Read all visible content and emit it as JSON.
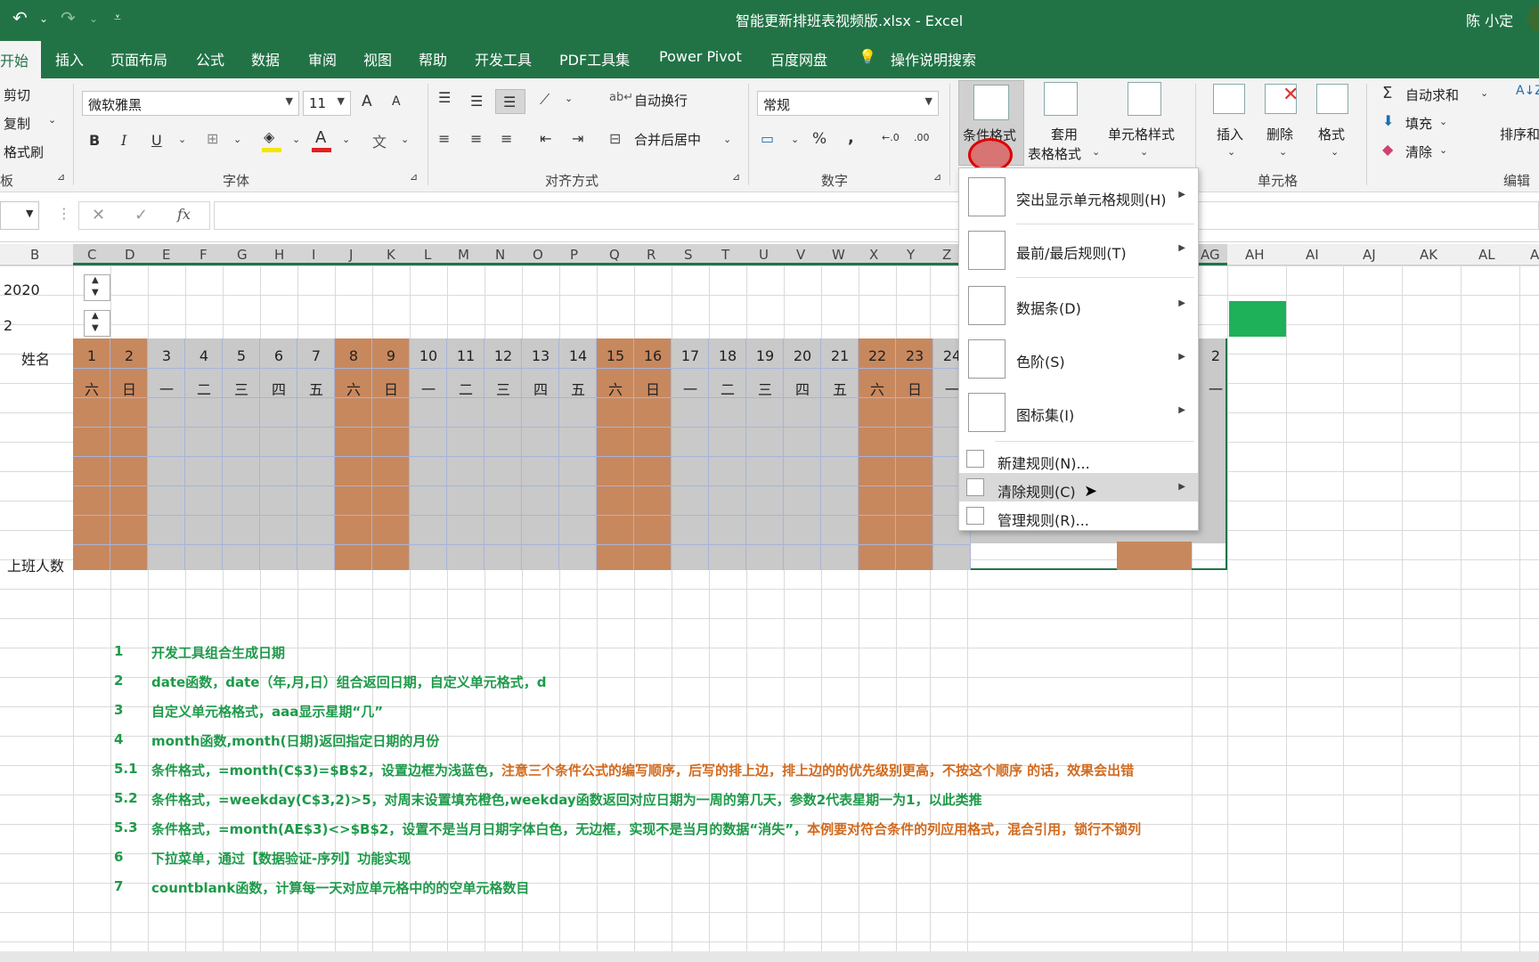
{
  "title": {
    "file": "智能更新排班表视频版.xlsx - Excel",
    "user": "陈 小定"
  },
  "tabs": [
    "开始",
    "插入",
    "页面布局",
    "公式",
    "数据",
    "审阅",
    "视图",
    "帮助",
    "开发工具",
    "PDF工具集",
    "Power Pivot",
    "百度网盘",
    "操作说明搜索"
  ],
  "ribbon": {
    "clipboard": {
      "cut": "剪切",
      "copy": "复制",
      "painter": "格式刷",
      "label": "板"
    },
    "font": {
      "name": "微软雅黑",
      "size": "11",
      "label": "字体",
      "bold": "B",
      "italic": "I",
      "underline": "U",
      "wen": "文",
      "grow": "A",
      "shrink": "A",
      "color_a": "A"
    },
    "align": {
      "wrap": "自动换行",
      "merge": "合并后居中",
      "label": "对齐方式"
    },
    "number": {
      "format": "常规",
      "label": "数字",
      "pct": "%",
      "comma": ",",
      "inc": "←.0",
      "dec": ".00"
    },
    "styles": {
      "cf": "条件格式",
      "table": "套用",
      "table2": "表格格式",
      "cell": "单元格样式"
    },
    "cells": {
      "insert": "插入",
      "delete": "删除",
      "format": "格式",
      "label": "单元格"
    },
    "edit": {
      "autosum": "自动求和",
      "fill": "填充",
      "clear": "清除",
      "sort": "排序和",
      "label": "编辑",
      "sigma": "Σ"
    }
  },
  "formula": {
    "cancel": "✕",
    "enter": "✓",
    "fx": "fx"
  },
  "columns": [
    "B",
    "C",
    "D",
    "E",
    "F",
    "G",
    "H",
    "I",
    "J",
    "K",
    "L",
    "M",
    "N",
    "O",
    "P",
    "Q",
    "R",
    "S",
    "T",
    "U",
    "V",
    "W",
    "X",
    "Y",
    "Z",
    "AG",
    "AH",
    "AI",
    "AJ",
    "AK",
    "AL",
    "A"
  ],
  "sheet": {
    "year": "2020",
    "month": "2",
    "name_label": "姓名",
    "count_label": "上班人数",
    "days": [
      "1",
      "2",
      "3",
      "4",
      "5",
      "6",
      "7",
      "8",
      "9",
      "10",
      "11",
      "12",
      "13",
      "14",
      "15",
      "16",
      "17",
      "18",
      "19",
      "20",
      "21",
      "22",
      "23",
      "24"
    ],
    "weekdays": [
      "六",
      "日",
      "一",
      "二",
      "三",
      "四",
      "五",
      "六",
      "日",
      "一",
      "二",
      "三",
      "四",
      "五",
      "六",
      "日",
      "一",
      "二",
      "三",
      "四",
      "五",
      "六",
      "日",
      "一"
    ],
    "last_day": "2",
    "last_wd": "一"
  },
  "notes": [
    {
      "n": "1",
      "t": "开发工具组合生成日期",
      "o": ""
    },
    {
      "n": "2",
      "t": "date函数，date（年,月,日）组合返回日期，自定义单元格式，d",
      "o": ""
    },
    {
      "n": "3",
      "t": "自定义单元格格式，aaa显示星期“几”",
      "o": ""
    },
    {
      "n": "4",
      "t": "month函数,month(日期)返回指定日期的月份",
      "o": ""
    },
    {
      "n": "5.1",
      "t": "条件格式，=month(C$3)=$B$2，设置边框为浅蓝色，",
      "o": "注意三个条件公式的编写顺序，后写的排上边，排上边的的优先级别更高，不按这个顺序 的话，效果会出错"
    },
    {
      "n": "5.2",
      "t": "条件格式，=weekday(C$3,2)>5，对周末设置填充橙色,weekday函数返回对应日期为一周的第几天，参数2代表星期一为1，以此类推",
      "o": ""
    },
    {
      "n": "5.3",
      "t": "条件格式，=month(AE$3)<>$B$2，设置不是当月日期字体白色，无边框，实现不是当月的数据“消失”，",
      "o": "本例要对符合条件的列应用格式，混合引用，锁行不锁列"
    },
    {
      "n": "6",
      "t": "下拉菜单，通过【数据验证-序列】功能实现",
      "o": ""
    },
    {
      "n": "7",
      "t": "countblank函数，计算每一天对应单元格中的的空单元格数目",
      "o": ""
    }
  ],
  "menu": {
    "items": [
      {
        "label": "突出显示单元格规则(H)",
        "icon": "highlight-rules-icon"
      },
      {
        "label": "最前/最后规则(T)",
        "icon": "top-bottom-icon"
      },
      {
        "label": "数据条(D)",
        "icon": "data-bars-icon"
      },
      {
        "label": "色阶(S)",
        "icon": "color-scales-icon"
      },
      {
        "label": "图标集(I)",
        "icon": "icon-sets-icon"
      }
    ],
    "small": [
      {
        "label": "新建规则(N)...",
        "icon": "new-rule-icon"
      },
      {
        "label": "清除规则(C)",
        "icon": "clear-rules-icon"
      },
      {
        "label": "管理规则(R)...",
        "icon": "manage-rules-icon"
      }
    ]
  },
  "colors": {
    "green": "#217346",
    "orange": "#c8885e",
    "gray": "#c9c9c9",
    "note_green": "#1e9a4a",
    "note_orange": "#d26a1e",
    "fill_green": "#1fb05a"
  }
}
